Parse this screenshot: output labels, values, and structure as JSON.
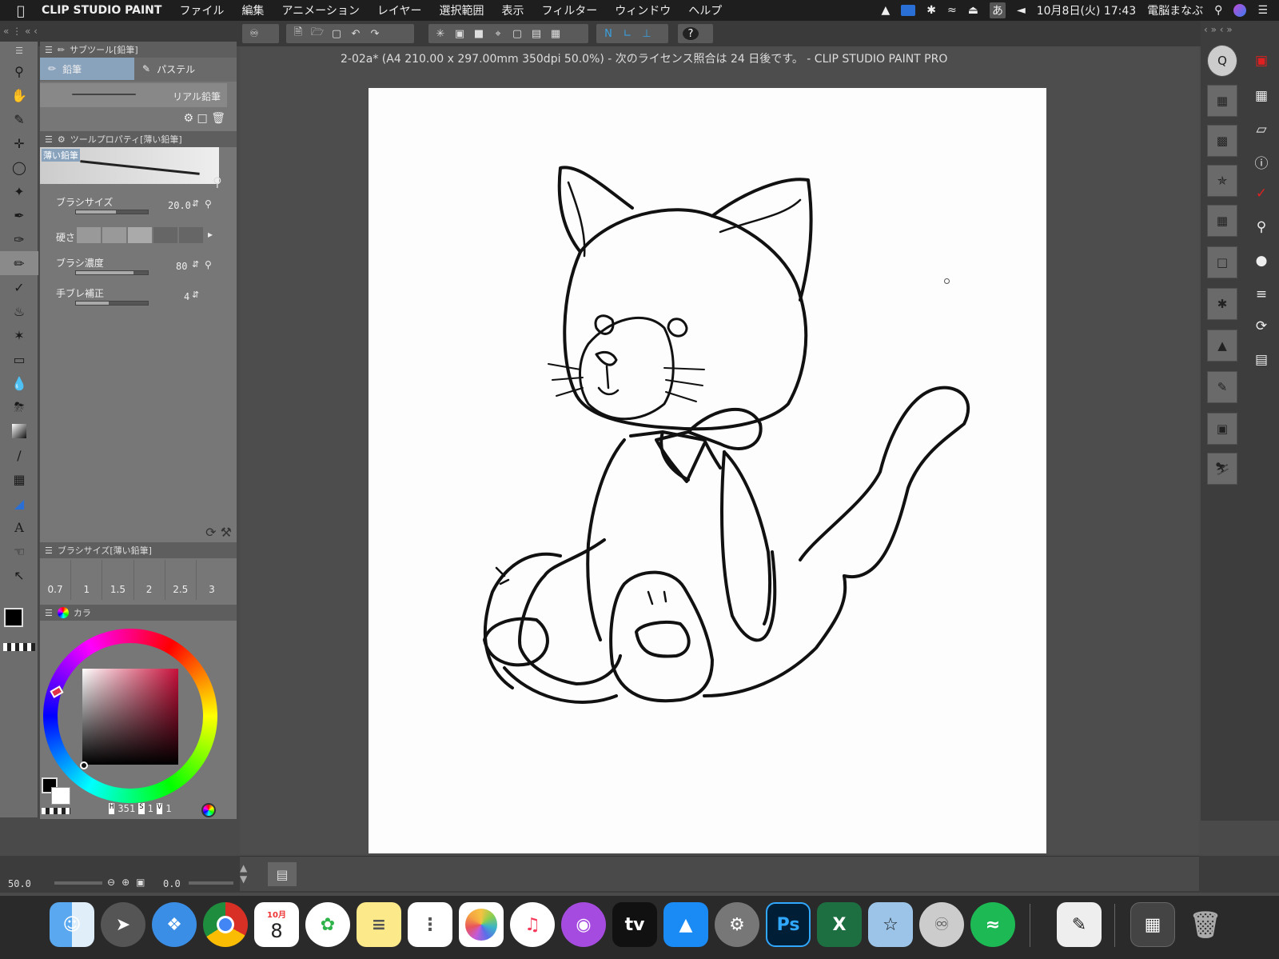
{
  "menubar": {
    "app_name": "CLIP STUDIO PAINT",
    "items": [
      "ファイル",
      "編集",
      "アニメーション",
      "レイヤー",
      "選択範囲",
      "表示",
      "フィルター",
      "ウィンドウ",
      "ヘルプ"
    ],
    "ime": "あ",
    "clock": "10月8日(火) 17:43",
    "user": "電脳まなぶ"
  },
  "document": {
    "title": "2-02a* (A4 210.00 x 297.00mm 350dpi 50.0%)  - 次のライセンス照合は 24 日後です。 - CLIP STUDIO PAINT PRO"
  },
  "subtool": {
    "header": "サブツール[鉛筆]",
    "tabs": [
      "鉛筆",
      "パステル"
    ],
    "active_tab": "鉛筆",
    "brush_name": "リアル鉛筆"
  },
  "tool_property": {
    "header": "ツールプロパティ[薄い鉛筆]",
    "preview_label": "薄い鉛筆",
    "brush_size": {
      "label": "ブラシサイズ",
      "value": "20.0",
      "fraction": 0.55
    },
    "hardness": {
      "label": "硬さ"
    },
    "density": {
      "label": "ブラシ濃度",
      "value": "80",
      "fraction": 0.8
    },
    "stabilization": {
      "label": "手ブレ補正",
      "value": "4",
      "fraction": 0.45
    }
  },
  "brushsize": {
    "header": "ブラシサイズ[薄い鉛筆]",
    "sizes": [
      "0.7",
      "1",
      "1.5",
      "2",
      "2.5",
      "3"
    ]
  },
  "color": {
    "tab_label": "カラ",
    "h": "351",
    "s": "1",
    "v": "1",
    "h_label": "H",
    "s_label": "S",
    "v_label": "V",
    "accent": "#c8103a"
  },
  "status": {
    "zoom": "50.0",
    "angle": "0.0"
  },
  "dock": {
    "calendar_month": "10月",
    "calendar_day": "8",
    "tv_label": "tv",
    "ps_label": "Ps",
    "excel_label": "X"
  }
}
